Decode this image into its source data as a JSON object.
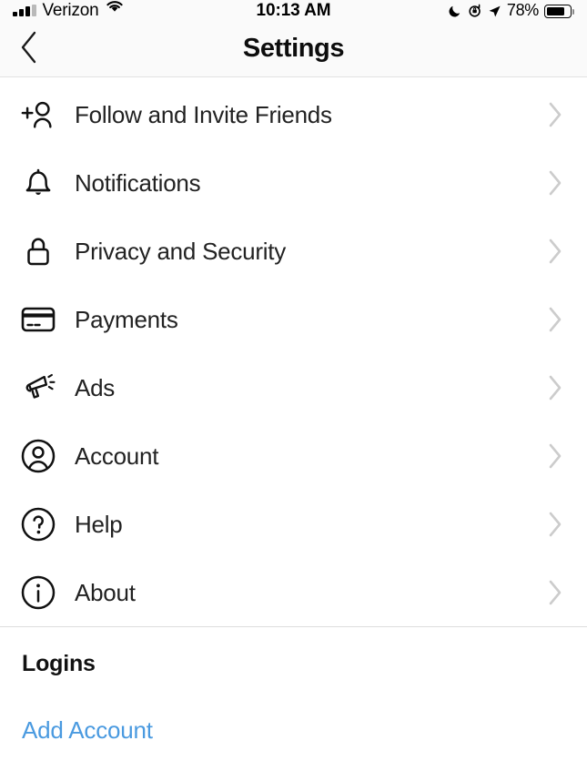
{
  "status_bar": {
    "carrier": "Verizon",
    "time": "10:13 AM",
    "battery_percent": "78%",
    "battery_level": 78,
    "icons": {
      "signal": "signal-bars-icon",
      "wifi": "wifi-icon",
      "dnd": "crescent-moon-icon",
      "rotation_lock": "rotation-lock-icon",
      "location": "location-arrow-icon",
      "battery": "battery-icon"
    }
  },
  "header": {
    "title": "Settings",
    "back_icon": "chevron-left-icon"
  },
  "settings": {
    "items": [
      {
        "label": "Follow and Invite Friends",
        "icon": "person-add-icon",
        "chevron": "chevron-right-icon"
      },
      {
        "label": "Notifications",
        "icon": "bell-icon",
        "chevron": "chevron-right-icon"
      },
      {
        "label": "Privacy and Security",
        "icon": "lock-icon",
        "chevron": "chevron-right-icon"
      },
      {
        "label": "Payments",
        "icon": "credit-card-icon",
        "chevron": "chevron-right-icon"
      },
      {
        "label": "Ads",
        "icon": "megaphone-icon",
        "chevron": "chevron-right-icon"
      },
      {
        "label": "Account",
        "icon": "account-circle-icon",
        "chevron": "chevron-right-icon"
      },
      {
        "label": "Help",
        "icon": "question-circle-icon",
        "chevron": "chevron-right-icon"
      },
      {
        "label": "About",
        "icon": "info-circle-icon",
        "chevron": "chevron-right-icon"
      }
    ]
  },
  "logins": {
    "heading": "Logins",
    "add_account_label": "Add Account"
  },
  "colors": {
    "link_blue": "#4a9ae0",
    "text_primary": "#222222",
    "chevron_gray": "#cccccc",
    "divider": "#dedede",
    "header_bg": "#fafafa"
  }
}
